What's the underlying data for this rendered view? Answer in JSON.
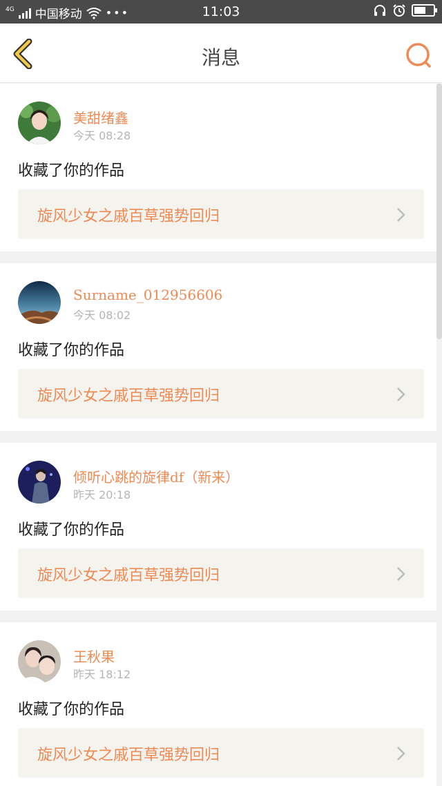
{
  "status_bar": {
    "network": "4G",
    "carrier": "中国移动",
    "dots": "•••",
    "time": "11:03",
    "battery_level": 0.6
  },
  "nav": {
    "title": "消息"
  },
  "colors": {
    "accent": "#ee8a55",
    "back_arrow_fill": "#f2c94c",
    "username": "#ee8a55",
    "work_title": "#ee8a55"
  },
  "messages": [
    {
      "username": "美甜绪鑫",
      "time": "今天 08:28",
      "action": "收藏了你的作品",
      "work_title": "旋风少女之戚百草强势回归"
    },
    {
      "username": "Surname_012956606",
      "time": "今天 08:02",
      "action": "收藏了你的作品",
      "work_title": "旋风少女之戚百草强势回归"
    },
    {
      "username": "倾听心跳的旋律df（新来）",
      "time": "昨天 20:18",
      "action": "收藏了你的作品",
      "work_title": "旋风少女之戚百草强势回归"
    },
    {
      "username": "王秋果",
      "time": "昨天 18:12",
      "action": "收藏了你的作品",
      "work_title": "旋风少女之戚百草强势回归"
    }
  ]
}
